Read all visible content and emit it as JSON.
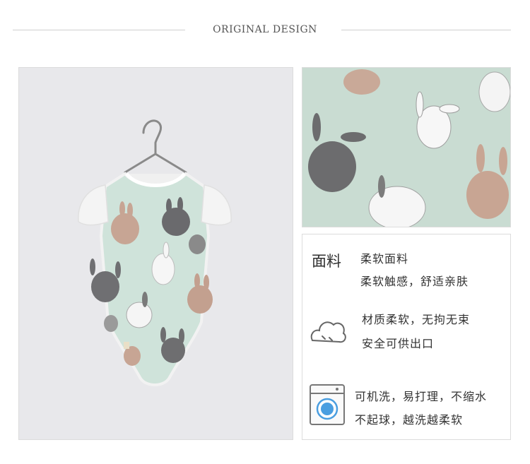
{
  "header": {
    "title": "ORIGINAL DESIGN"
  },
  "info": {
    "fabric_heading": "面料",
    "fabric_name": "柔软面料",
    "fabric_desc": "柔软触感，舒适亲肤",
    "comfort_line1": "材质柔软，无拘无束",
    "comfort_line2": "安全可供出口",
    "wash_line1": "可机洗，易打理，不缩水",
    "wash_line2": "不起球，越洗越柔软"
  },
  "icons": [
    "cloud-icon",
    "washing-machine-icon"
  ],
  "colors": {
    "fabric_mint": "#c9dcd2",
    "photo_bg": "#e8e8eb",
    "icon_blue": "#4a9ee0"
  }
}
